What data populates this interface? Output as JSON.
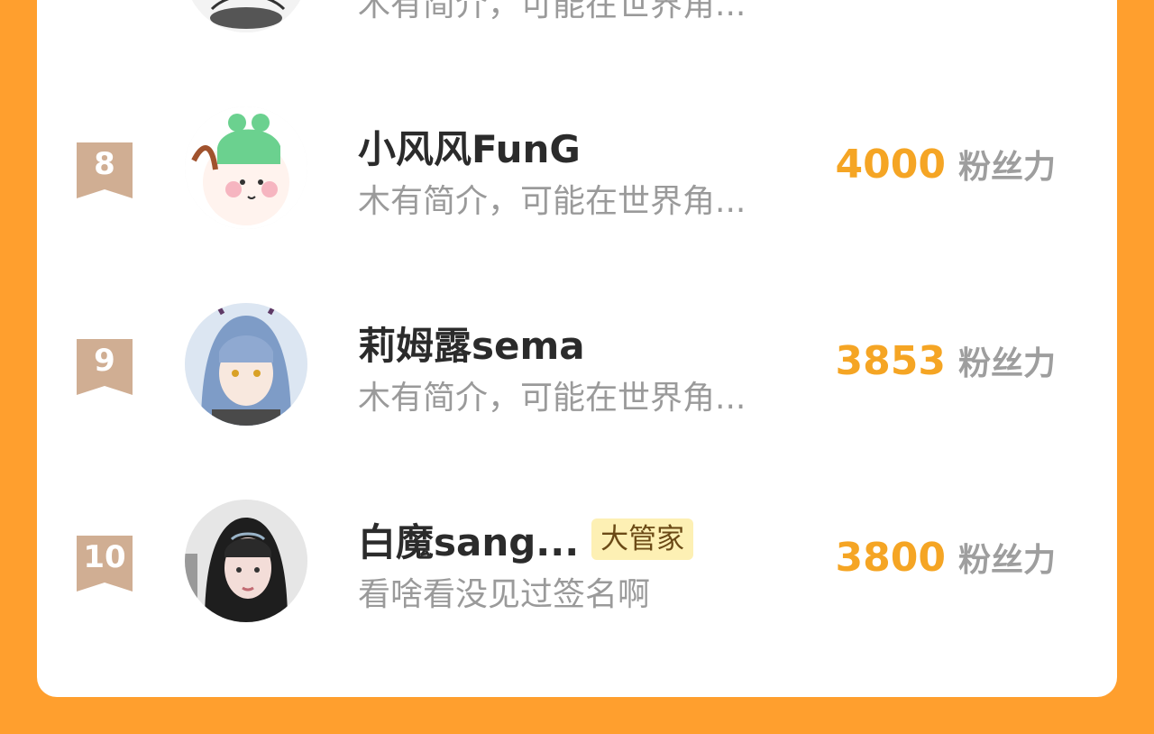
{
  "ranking": {
    "partial_row": {
      "bio": "木有简介，可能在世界角..."
    },
    "rows": [
      {
        "rank": "8",
        "name": "小风风FunG",
        "bio": "木有简介，可能在世界角...",
        "score": "4000",
        "unit": "粉丝力",
        "badge": ""
      },
      {
        "rank": "9",
        "name": "莉姆露sema",
        "bio": "木有简介，可能在世界角...",
        "score": "3853",
        "unit": "粉丝力",
        "badge": ""
      },
      {
        "rank": "10",
        "name": "白魔sang...",
        "bio": "看啥看没见过签名啊",
        "score": "3800",
        "unit": "粉丝力",
        "badge": "大管家"
      }
    ]
  },
  "colors": {
    "background": "#FF9F2E",
    "panel": "#FFFFFF",
    "score": "#F5A524",
    "rank_ribbon": "#D0AE93",
    "badge_bg": "#FDF0B4"
  },
  "icons": {
    "rank": "ribbon-bookmark-icon"
  }
}
